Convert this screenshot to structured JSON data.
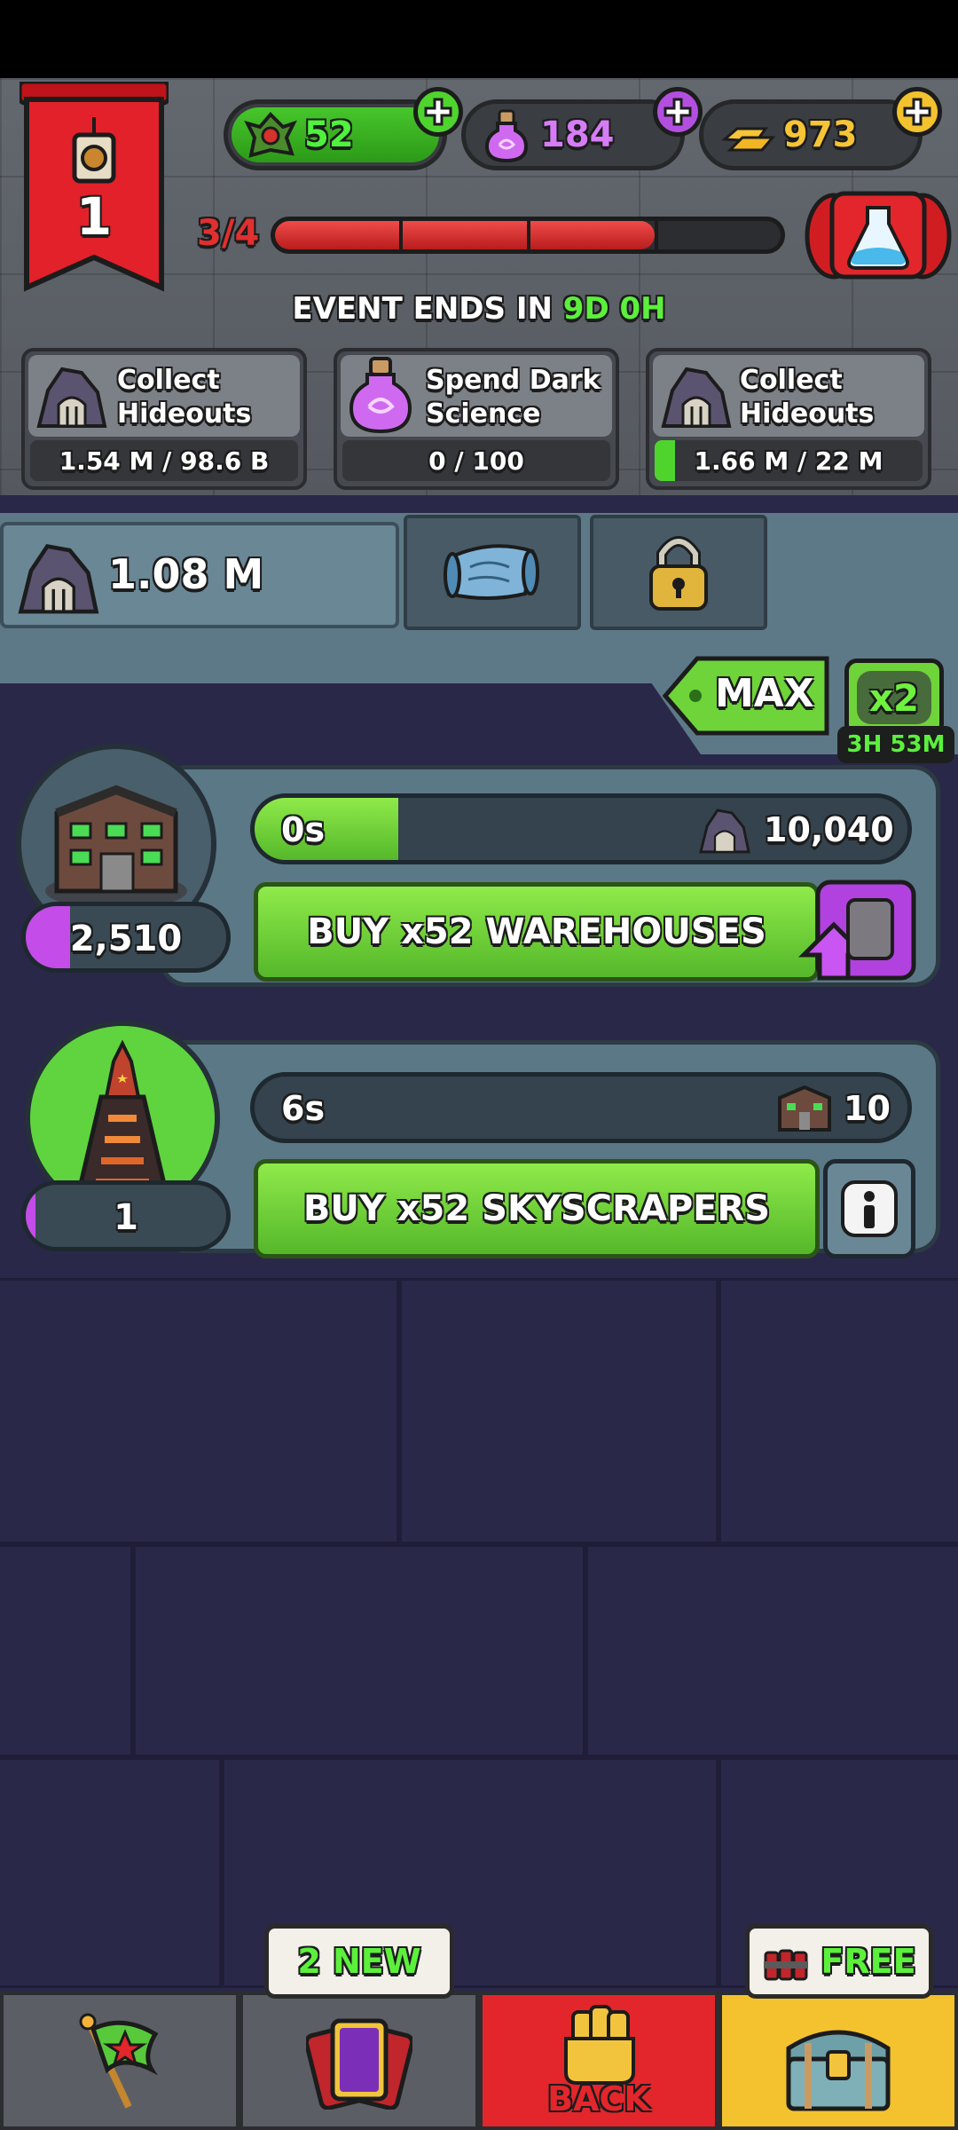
{
  "currencies": {
    "green": {
      "value": "52",
      "icon": "minion-icon",
      "color": "#3fb81e"
    },
    "dark_science": {
      "value": "184",
      "icon": "potion-icon",
      "color": "#c455e6"
    },
    "gold": {
      "value": "973",
      "icon": "gold-bars-icon",
      "color": "#f2c230"
    }
  },
  "level": {
    "value": "1",
    "progress_text": "3/4",
    "progress_fraction": 0.75
  },
  "event": {
    "label": "EVENT ENDS IN",
    "days": "9D",
    "hours": "0H"
  },
  "tasks": [
    {
      "line1": "Collect",
      "line2": "Hideouts",
      "progress": "1.54 M / 98.6 B",
      "icon": "hideout-icon",
      "fill": 0.0
    },
    {
      "line1": "Spend Dark",
      "line2": "Science",
      "progress": "0 / 100",
      "icon": "potion-icon",
      "fill": 0.0
    },
    {
      "line1": "Collect",
      "line2": "Hideouts",
      "progress": "1.66 M / 22 M",
      "icon": "hideout-icon",
      "fill": 0.075
    }
  ],
  "resource": {
    "value": "1.08 M",
    "icon": "hideout-icon"
  },
  "tabs": [
    {
      "icon": "map-scroll-icon"
    },
    {
      "icon": "padlock-icon"
    }
  ],
  "multiplier": {
    "max_label": "MAX",
    "boost_label": "x2",
    "boost_timer": "3H 53M"
  },
  "generators": [
    {
      "name": "warehouse",
      "count": "2,510",
      "timer": "0s",
      "output": "10,040",
      "buy_label": "BUY x52 WAREHOUSES",
      "progress": 0.22,
      "count_fill": 0.22,
      "side_icon": "card-upgrade-icon"
    },
    {
      "name": "skyscraper",
      "count": "1",
      "timer": "6s",
      "output": "10",
      "buy_label": "BUY x52 SKYSCRAPERS",
      "progress": 0.0,
      "count_fill": 0.05,
      "side_icon": "info-icon"
    }
  ],
  "nav": {
    "cards_badge": "2 NEW",
    "back_label": "BACK",
    "free_badge": "FREE",
    "items": [
      {
        "icon": "flag-icon"
      },
      {
        "icon": "cards-icon"
      },
      {
        "icon": "fist-icon"
      },
      {
        "icon": "treasure-chest-icon"
      }
    ]
  }
}
